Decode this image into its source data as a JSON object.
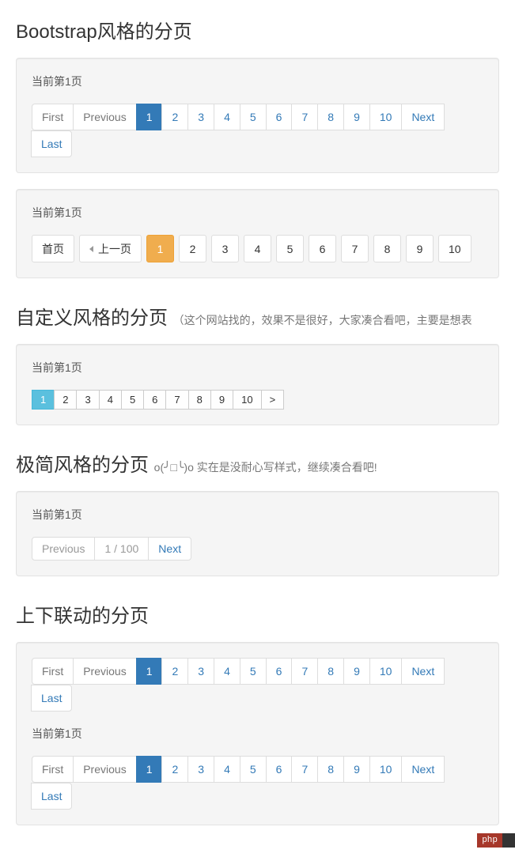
{
  "section1": {
    "title": "Bootstrap风格的分页",
    "status": "当前第1页",
    "first": "First",
    "previous": "Previous",
    "pages": [
      "1",
      "2",
      "3",
      "4",
      "5",
      "6",
      "7",
      "8",
      "9",
      "10"
    ],
    "next": "Next",
    "last": "Last",
    "active": 1
  },
  "section2": {
    "status": "当前第1页",
    "first": "首页",
    "previous": "上一页",
    "pages": [
      "1",
      "2",
      "3",
      "4",
      "5",
      "6",
      "7",
      "8",
      "9",
      "10"
    ],
    "active": 1
  },
  "section3": {
    "title": "自定义风格的分页",
    "subtitle": "（这个网站找的，效果不是很好，大家凑合看吧，主要是想表",
    "status": "当前第1页",
    "pages": [
      "1",
      "2",
      "3",
      "4",
      "5",
      "6",
      "7",
      "8",
      "9",
      "10"
    ],
    "next": ">",
    "active": 1
  },
  "section4": {
    "title": "极简风格的分页",
    "subtitle": "o(╯□╰)o 实在是没耐心写样式，继续凑合看吧!",
    "status": "当前第1页",
    "previous": "Previous",
    "info": "1 / 100",
    "next": "Next"
  },
  "section5": {
    "title": "上下联动的分页",
    "first": "First",
    "previous": "Previous",
    "pages": [
      "1",
      "2",
      "3",
      "4",
      "5",
      "6",
      "7",
      "8",
      "9",
      "10"
    ],
    "next": "Next",
    "last": "Last",
    "status": "当前第1页",
    "active": 1
  },
  "badge": {
    "left": "php",
    "right": ""
  }
}
